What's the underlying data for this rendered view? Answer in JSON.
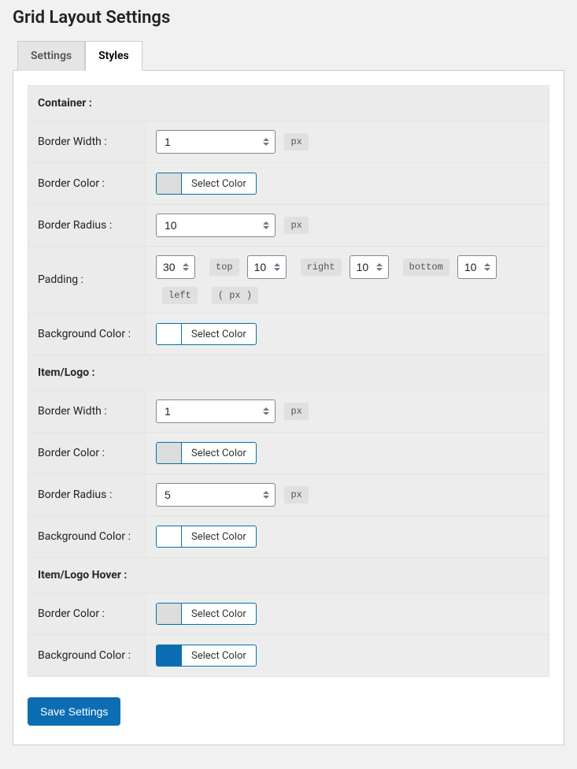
{
  "page_title": "Grid Layout Settings",
  "tabs": {
    "settings": "Settings",
    "styles": "Styles"
  },
  "active_tab": "styles",
  "save_label": "Save Settings",
  "select_color_label": "Select Color",
  "unit_px": "px",
  "padding_labels": {
    "top": "top",
    "right": "right",
    "bottom": "bottom",
    "left": "left",
    "px_paren": "( px )"
  },
  "sections": {
    "container": {
      "header": "Container :",
      "border_width": {
        "label": "Border Width :",
        "value": "1"
      },
      "border_color": {
        "label": "Border Color :",
        "value": "#dddddd"
      },
      "border_radius": {
        "label": "Border Radius :",
        "value": "10"
      },
      "padding": {
        "label": "Padding :",
        "top": "30",
        "right": "10",
        "bottom": "10",
        "left": "10"
      },
      "background_color": {
        "label": "Background Color :",
        "value": "#ffffff"
      }
    },
    "item": {
      "header": "Item/Logo :",
      "border_width": {
        "label": "Border Width :",
        "value": "1"
      },
      "border_color": {
        "label": "Border Color :",
        "value": "#dddddd"
      },
      "border_radius": {
        "label": "Border Radius :",
        "value": "5"
      },
      "background_color": {
        "label": "Background Color :",
        "value": "#ffffff"
      }
    },
    "hover": {
      "header": "Item/Logo Hover :",
      "border_color": {
        "label": "Border Color :",
        "value": "#dddddd"
      },
      "background_color": {
        "label": "Background Color :",
        "value": "#0c6db3"
      }
    }
  }
}
